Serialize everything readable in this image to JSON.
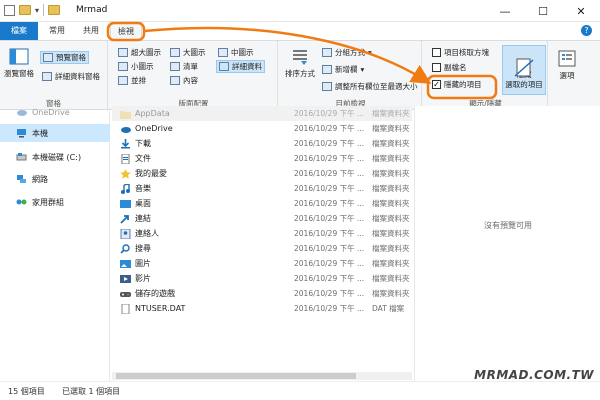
{
  "window": {
    "title": "Mrmad",
    "controls": {
      "minimize": "—",
      "maximize": "☐",
      "close": "✕"
    }
  },
  "tabs": [
    {
      "label": "檔案"
    },
    {
      "label": "常用"
    },
    {
      "label": "共用"
    },
    {
      "label": "檢視"
    }
  ],
  "ribbon": {
    "panes": {
      "label": "窗格",
      "navigation_pane": "瀏覽窗格",
      "preview_pane": "預覽窗格",
      "details_pane": "詳細資料窗格"
    },
    "layout": {
      "label": "版面配置",
      "items": [
        "超大圖示",
        "大圖示",
        "中圖示",
        "小圖示",
        "清單",
        "詳細資料",
        "並排",
        "內容"
      ]
    },
    "current_view": {
      "label": "目前檢視",
      "sort_by": "排序方式",
      "group_by": "分組方式",
      "add_columns": "新增欄",
      "size_all_columns": "調整所有欄位至最適大小"
    },
    "show_hide": {
      "label": "顯示/隱藏",
      "item_checkboxes": "項目核取方塊",
      "file_name_extensions": "副檔名",
      "hidden_items": "隱藏的項目",
      "hidden_items_checked": true,
      "hide_selected": "隱藏\n選取的項目",
      "options": "選項"
    }
  },
  "nav": {
    "items": [
      {
        "label": "OneDrive"
      },
      {
        "label": "本機"
      },
      {
        "label": "本機磁碟 (C:)"
      },
      {
        "label": "網路"
      },
      {
        "label": "家用群組"
      }
    ]
  },
  "files": [
    {
      "name": "AppData",
      "date": "2016/10/29 下午 ...",
      "type": "檔案資料夾"
    },
    {
      "name": "OneDrive",
      "date": "2016/10/29 下午 ...",
      "type": "檔案資料夾"
    },
    {
      "name": "下載",
      "date": "2016/10/29 下午 ...",
      "type": "檔案資料夾"
    },
    {
      "name": "文件",
      "date": "2016/10/29 下午 ...",
      "type": "檔案資料夾"
    },
    {
      "name": "我的最愛",
      "date": "2016/10/29 下午 ...",
      "type": "檔案資料夾"
    },
    {
      "name": "音樂",
      "date": "2016/10/29 下午 ...",
      "type": "檔案資料夾"
    },
    {
      "name": "桌面",
      "date": "2016/10/29 下午 ...",
      "type": "檔案資料夾"
    },
    {
      "name": "連結",
      "date": "2016/10/29 下午 ...",
      "type": "檔案資料夾"
    },
    {
      "name": "連絡人",
      "date": "2016/10/29 下午 ...",
      "type": "檔案資料夾"
    },
    {
      "name": "搜尋",
      "date": "2016/10/29 下午 ...",
      "type": "檔案資料夾"
    },
    {
      "name": "圖片",
      "date": "2016/10/29 下午 ...",
      "type": "檔案資料夾"
    },
    {
      "name": "影片",
      "date": "2016/10/29 下午 ...",
      "type": "檔案資料夾"
    },
    {
      "name": "儲存的遊戲",
      "date": "2016/10/29 下午 ...",
      "type": "檔案資料夾"
    },
    {
      "name": "NTUSER.DAT",
      "date": "2016/10/29 下午 ...",
      "type": "DAT 檔案"
    }
  ],
  "preview": {
    "message": "沒有預覽可用"
  },
  "status": {
    "item_count": "15 個項目",
    "selected": "已選取 1 個項目"
  },
  "watermark": "MRMAD.COM.TW",
  "colors": {
    "accent": "#1979ca",
    "annotation": "#f07b12",
    "selection": "#cce8ff"
  }
}
